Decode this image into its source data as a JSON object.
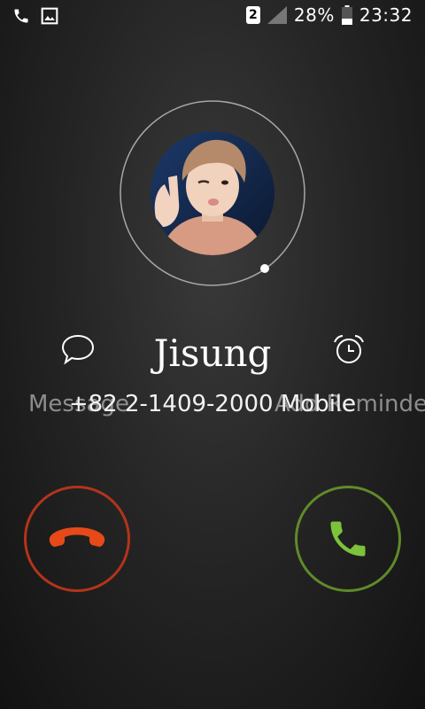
{
  "status_bar": {
    "sim_slot": "2",
    "battery": "28%",
    "time": "23:32"
  },
  "caller": {
    "name": "Jisung",
    "number": "+82 2-1409-2000 Mobile"
  },
  "actions": {
    "message_label": "Message",
    "reminder_label": "Add Reminder"
  },
  "colors": {
    "decline": "#e64a19",
    "decline_ring": "#b3341b",
    "answer": "#7cc23a",
    "answer_ring": "#5f8a2a"
  },
  "icons": {
    "status_left": [
      "phone-icon",
      "image-icon"
    ],
    "status_right": [
      "sim-badge",
      "signal-icon",
      "battery-icon"
    ],
    "message": "message-bubble-icon",
    "reminder": "alarm-clock-icon",
    "decline": "hang-up-icon",
    "answer": "phone-answer-icon"
  }
}
